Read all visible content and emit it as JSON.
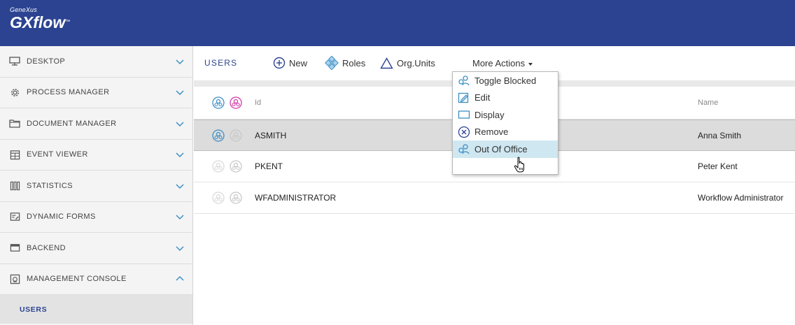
{
  "header": {
    "brand_top": "GeneXus",
    "brand_main": "GXflow",
    "brand_tm": "™",
    "bg_color": "#2c4391"
  },
  "sidebar": {
    "items": [
      {
        "label": "DESKTOP",
        "icon": "monitor-icon",
        "expanded": false
      },
      {
        "label": "PROCESS MANAGER",
        "icon": "gear-icon",
        "expanded": false
      },
      {
        "label": "DOCUMENT MANAGER",
        "icon": "folder-icon",
        "expanded": false
      },
      {
        "label": "EVENT VIEWER",
        "icon": "calendar-icon",
        "expanded": false
      },
      {
        "label": "STATISTICS",
        "icon": "bar-chart-icon",
        "expanded": false
      },
      {
        "label": "DYNAMIC FORMS",
        "icon": "form-icon",
        "expanded": false
      },
      {
        "label": "BACKEND",
        "icon": "server-icon",
        "expanded": false
      },
      {
        "label": "MANAGEMENT CONSOLE",
        "icon": "console-icon",
        "expanded": true
      }
    ],
    "sub_item": "USERS"
  },
  "toolbar": {
    "title": "USERS",
    "new_label": "New",
    "roles_label": "Roles",
    "orgunits_label": "Org.Units",
    "more_label": "More Actions"
  },
  "grid": {
    "columns": {
      "id": "Id",
      "name": "Name"
    },
    "rows": [
      {
        "id": "ASMITH",
        "name": "Anna Smith",
        "selected": true
      },
      {
        "id": "PKENT",
        "name": "Peter Kent",
        "selected": false
      },
      {
        "id": "WFADMINISTRATOR",
        "name": "Workflow Administrator",
        "selected": false
      }
    ]
  },
  "menu": {
    "items": [
      {
        "label": "Toggle Blocked",
        "icon": "users-icon"
      },
      {
        "label": "Edit",
        "icon": "edit-icon"
      },
      {
        "label": "Display",
        "icon": "display-icon"
      },
      {
        "label": "Remove",
        "icon": "remove-icon"
      },
      {
        "label": "Out Of Office",
        "icon": "users-icon",
        "hovered": true
      }
    ]
  },
  "colors": {
    "accent": "#2c4391",
    "icon_blue": "#3d8fc4",
    "icon_pink": "#d13aa8",
    "hover": "#cfe7f1"
  }
}
